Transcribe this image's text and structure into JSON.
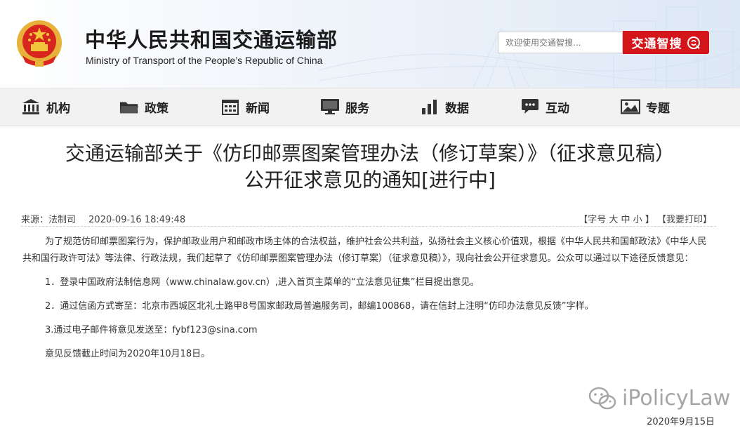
{
  "header": {
    "site_title": "中华人民共和国交通运输部",
    "site_subtitle": "Ministry of Transport of the People’s Republic of China",
    "search_placeholder": "欢迎使用交通智搜...",
    "search_button_label": "交通智搜"
  },
  "nav": {
    "items": [
      {
        "label": "机构",
        "icon": "building-icon"
      },
      {
        "label": "政策",
        "icon": "folder-icon"
      },
      {
        "label": "新闻",
        "icon": "calendar-grid-icon"
      },
      {
        "label": "服务",
        "icon": "monitor-icon"
      },
      {
        "label": "数据",
        "icon": "bar-chart-icon"
      },
      {
        "label": "互动",
        "icon": "chat-bubble-icon"
      },
      {
        "label": "专题",
        "icon": "image-icon"
      }
    ]
  },
  "article": {
    "title_line1": "交通运输部关于《仿印邮票图案管理办法（修订草案）》（征求意见稿）",
    "title_line2": "公开征求意见的通知[进行中]",
    "source": "来源：法制司",
    "datetime": "2020-09-16 18:49:48",
    "font_size_prefix": "【字号",
    "font_large": "大",
    "font_medium": "中",
    "font_small": "小",
    "font_size_suffix": "】",
    "print_label": "【我要打印】",
    "paragraph1": "为了规范仿印邮票图案行为，保护邮政业用户和邮政市场主体的合法权益，维护社会公共利益，弘扬社会主义核心价值观，根据《中华人民共和国邮政法》《中华人民共和国行政许可法》等法律、行政法规，我们起草了《仿印邮票图案管理办法（修订草案）（征求意见稿）》，现向社会公开征求意见。公众可以通过以下途径反馈意见：",
    "item1": "1．登录中国政府法制信息网（www.chinalaw.gov.cn）,进入首页主菜单的“立法意见征集”栏目提出意见。",
    "item2": "2．通过信函方式寄至：北京市西城区北礼士路甲8号国家邮政局普遍服务司，邮编100868，请在信封上注明“仿印办法意见反馈”字样。",
    "item3": "3.通过电子邮件将意见发送至：fybf123@sina.com",
    "deadline": "意见反馈截止时间为2020年10月18日。",
    "signature_date": "2020年9月15日"
  },
  "watermark": {
    "text": "iPolicyLaw"
  },
  "colors": {
    "accent_red": "#d4161b",
    "nav_bg": "#f2f2f2"
  }
}
